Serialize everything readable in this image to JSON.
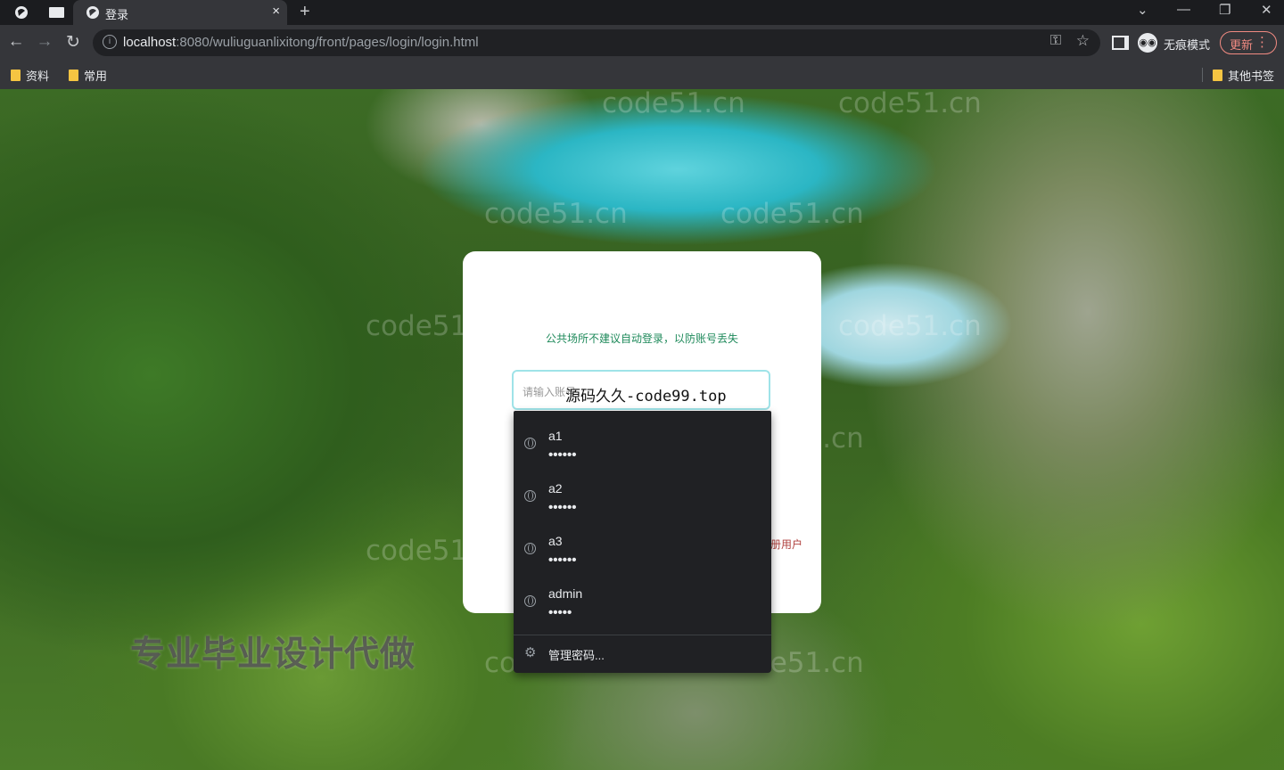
{
  "browser": {
    "tab": {
      "title": "登录",
      "close_icon": "×"
    },
    "new_tab_icon": "+",
    "window_controls": {
      "dropdown": "⌄",
      "minimize": "—",
      "restore": "❐",
      "close": "✕"
    },
    "url": {
      "host": "localhost",
      "path": ":8080/wuliuguanlixitong/front/pages/login/login.html"
    },
    "incognito_label": "无痕模式",
    "update_label": "更新",
    "bookmarks": [
      {
        "label": "资料"
      },
      {
        "label": "常用"
      }
    ],
    "other_bookmarks_label": "其他书签"
  },
  "login": {
    "notice": "公共场所不建议自动登录，以防账号丢失",
    "username_placeholder": "请输入账号",
    "register_link_partial": "册用户"
  },
  "autofill": {
    "items": [
      {
        "username": "a1",
        "password_mask": "••••••"
      },
      {
        "username": "a2",
        "password_mask": "••••••"
      },
      {
        "username": "a3",
        "password_mask": "••••••"
      },
      {
        "username": "admin",
        "password_mask": "•••••"
      }
    ],
    "manage_label": "管理密码..."
  },
  "overlays": {
    "video_watermark": "源码久久-code99.top",
    "ad_text": "专业毕业设计代做",
    "tiled_watermark": "code51.cn"
  },
  "icons": [
    "globe-icon",
    "back-arrow-icon",
    "forward-arrow-icon",
    "reload-icon",
    "info-icon",
    "key-icon",
    "star-icon",
    "side-panel-icon",
    "incognito-icon",
    "more-vert-icon",
    "folder-icon",
    "gear-icon"
  ]
}
